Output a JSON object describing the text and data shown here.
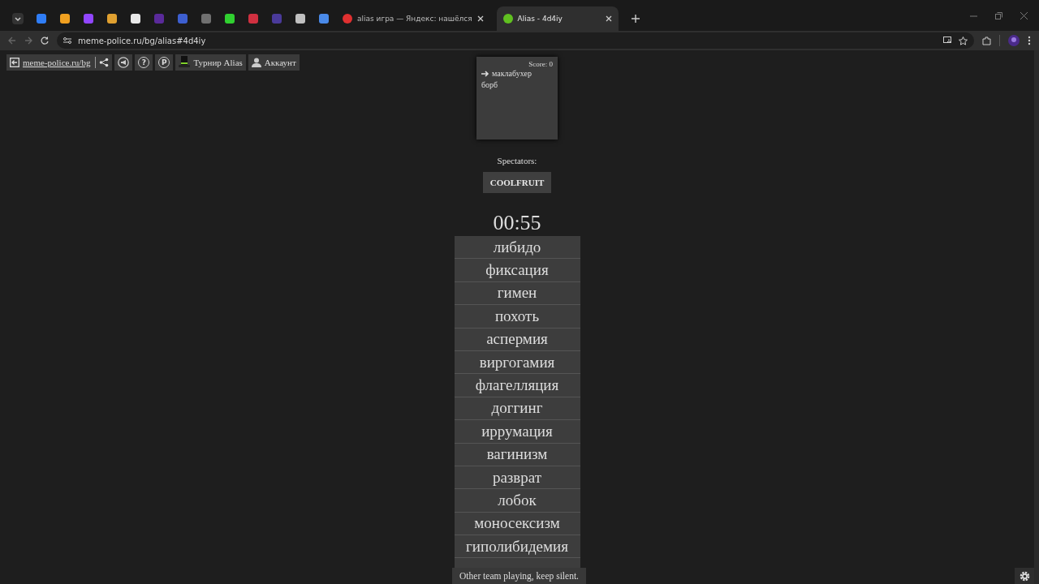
{
  "browser": {
    "tabs": [
      {
        "kind": "pinned",
        "color": "#2f7df6",
        "selected": false
      },
      {
        "kind": "pinned",
        "color": "#f0a020",
        "selected": false
      },
      {
        "kind": "pinned",
        "color": "#9146ff",
        "selected": false
      },
      {
        "kind": "pinned",
        "color": "#e0a030",
        "selected": false
      },
      {
        "kind": "pinned",
        "color": "#e8e8e8",
        "selected": false
      },
      {
        "kind": "pinned",
        "color": "#5a2a9a",
        "selected": false
      },
      {
        "kind": "pinned",
        "color": "#3d5fd0",
        "selected": false
      },
      {
        "kind": "pinned",
        "color": "#707070",
        "selected": false
      },
      {
        "kind": "pinned",
        "color": "#30d030",
        "selected": false
      },
      {
        "kind": "pinned",
        "color": "#d03040",
        "selected": false
      },
      {
        "kind": "pinned",
        "color": "#4a3a9a",
        "selected": false
      },
      {
        "kind": "pinned",
        "color": "#c0c0c0",
        "selected": false
      },
      {
        "kind": "pinned",
        "color": "#4a8ae8",
        "selected": false
      },
      {
        "kind": "page",
        "color": "#e03030",
        "title": "alias игра — Яндекс: нашёлся",
        "selected": false
      },
      {
        "kind": "page",
        "color": "#60c020",
        "title": "Alias - 4d4iy",
        "selected": true
      }
    ],
    "url": "meme-police.ru/bg/alias#4d4iy"
  },
  "toolbar": [
    {
      "kind": "home",
      "label": "meme-police.ru/bg"
    },
    {
      "kind": "share"
    },
    {
      "kind": "announce"
    },
    {
      "kind": "glyph",
      "label": "?"
    },
    {
      "kind": "glyph",
      "label": "P"
    },
    {
      "kind": "tournament",
      "label": "Турнир Alias"
    },
    {
      "kind": "account",
      "label": "Аккаунт"
    }
  ],
  "team": {
    "score": "Score: 0",
    "players": [
      {
        "name": "маклабухер",
        "current": true
      },
      {
        "name": "борб",
        "current": false
      }
    ]
  },
  "spectators": {
    "title": "Spectators:",
    "names": [
      "COOLFRUIT"
    ]
  },
  "timer": "00:55",
  "words": [
    "либидо",
    "фиксация",
    "гимен",
    "похоть",
    "аспермия",
    "виргогамия",
    "флагелляция",
    "доггинг",
    "иррумация",
    "вагинизм",
    "разврат",
    "лобок",
    "моносексизм",
    "гиполибидемия"
  ],
  "notice": "Other team playing, keep silent."
}
